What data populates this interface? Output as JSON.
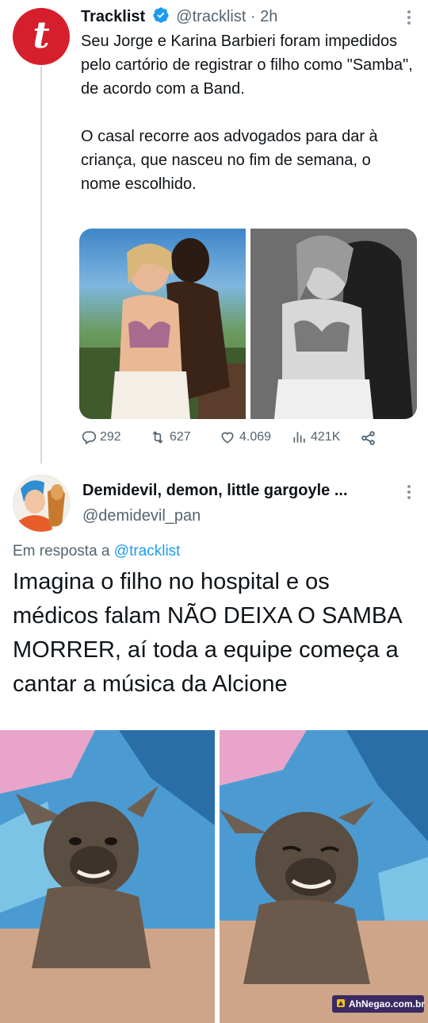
{
  "tweet1": {
    "avatar_letter": "t",
    "name": "Tracklist",
    "handle_time": "@tracklist · 2h",
    "paragraphs": [
      "Seu Jorge e Karina Barbieri foram impedidos pelo cartório de registrar o filho como \"Samba\", de acordo com a Band.",
      "O casal recorre aos advogados para dar à criança, que nasceu no fim de semana, o nome escolhido."
    ],
    "stats": {
      "replies": "292",
      "retweets": "627",
      "likes": "4.069",
      "views": "421K"
    }
  },
  "tweet2": {
    "name": "Demidevil, demon, little gargoyle ...",
    "handle": "@demidevil_pan",
    "reply_prefix": "Em resposta a",
    "reply_to": "@tracklist",
    "text": "Imagina o filho no hospital e os médicos falam NÃO DEIXA O SAMBA MORRER, aí toda a equipe começa a cantar a música da Alcione"
  },
  "watermark": "AhNegao.com.br",
  "colors": {
    "brand_red": "#d61f2c",
    "verified_blue": "#1d9bf0",
    "link_blue": "#1d9bf0",
    "secondary_text": "#536471"
  }
}
